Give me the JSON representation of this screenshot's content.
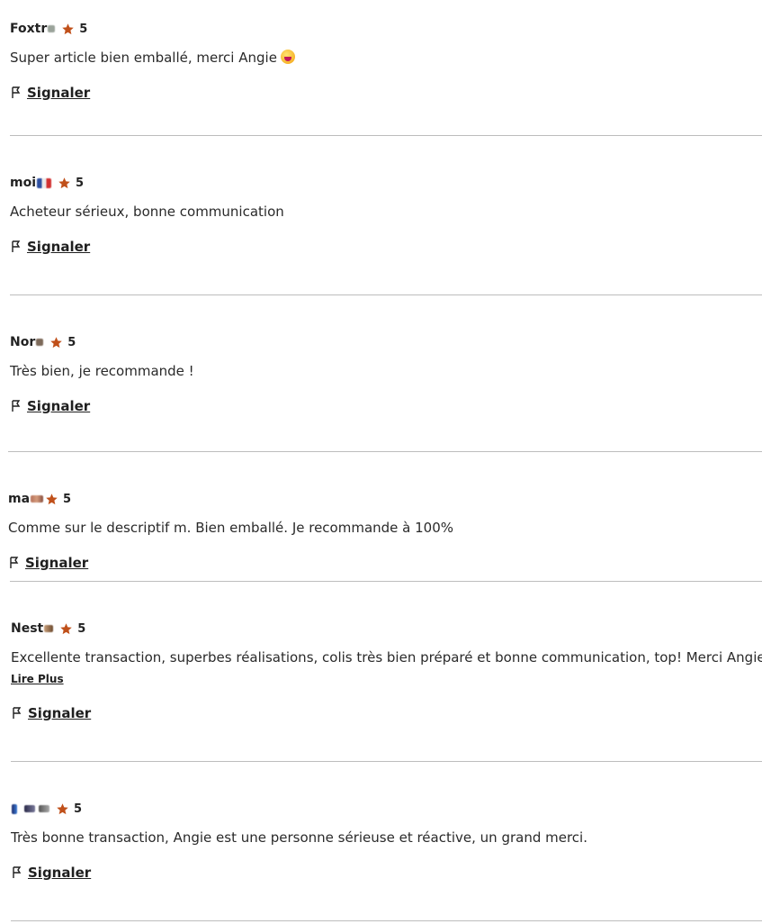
{
  "reviews": [
    {
      "name": "Foxtr",
      "rating": "5",
      "text": "Super article bien emballé, merci Angie",
      "has_emoji": true,
      "report_label": "Signaler"
    },
    {
      "name": "moi",
      "rating": "5",
      "text": "Acheteur sérieux, bonne communication",
      "report_label": "Signaler"
    },
    {
      "name": "Nor",
      "rating": "5",
      "text": "Très bien, je recommande !",
      "report_label": "Signaler"
    },
    {
      "name": "ma",
      "rating": "5",
      "text": "Comme sur le descriptif m. Bien emballé. Je recommande à 100%",
      "report_label": "Signaler"
    },
    {
      "name": "Nest",
      "rating": "5",
      "text": "Excellente transaction, superbes réalisations, colis très bien préparé et bonne communication, top! Merci Angie....",
      "read_more": "Lire Plus",
      "report_label": "Signaler"
    },
    {
      "name": "",
      "rating": "5",
      "text": "Très bonne transaction, Angie est une personne sérieuse et réactive, un grand merci.",
      "report_label": "Signaler"
    }
  ],
  "colors": {
    "star": "#c0501a",
    "divider": "#bdbdbd"
  },
  "icons": {
    "star": "star-icon",
    "flag": "flag-icon"
  }
}
